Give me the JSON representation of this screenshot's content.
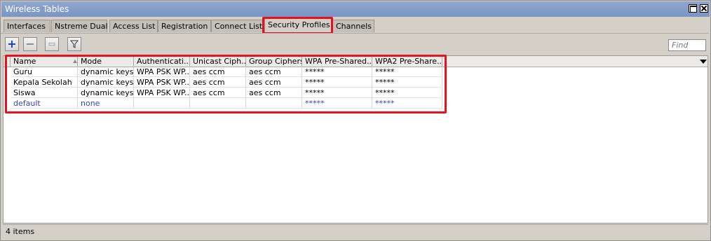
{
  "window": {
    "title": "Wireless Tables"
  },
  "tabs": [
    {
      "label": "Interfaces"
    },
    {
      "label": "Nstreme Dual"
    },
    {
      "label": "Access List"
    },
    {
      "label": "Registration"
    },
    {
      "label": "Connect List"
    },
    {
      "label": "Security Profiles",
      "active": true
    },
    {
      "label": "Channels"
    }
  ],
  "toolbar": {
    "add_icon": "plus-icon",
    "remove_icon": "minus-icon",
    "copy_icon": "comment-icon",
    "filter_icon": "filter-icon",
    "find_placeholder": "Find"
  },
  "table": {
    "columns": [
      "Name",
      "Mode",
      "Authenticati...",
      "Unicast Ciph...",
      "Group Ciphers",
      "WPA Pre-Shared...",
      "WPA2 Pre-Share..."
    ],
    "rows": [
      [
        "Guru",
        "dynamic keys",
        "WPA PSK WP...",
        "aes ccm",
        "aes ccm",
        "*****",
        "*****"
      ],
      [
        "Kepala Sekolah",
        "dynamic keys",
        "WPA PSK WP...",
        "aes ccm",
        "aes ccm",
        "*****",
        "*****"
      ],
      [
        "Siswa",
        "dynamic keys",
        "WPA PSK WP...",
        "aes ccm",
        "aes ccm",
        "*****",
        "*****"
      ],
      [
        "default",
        "none",
        "",
        "",
        "",
        "*****",
        "*****"
      ]
    ]
  },
  "status": {
    "items": "4 items"
  },
  "colors": {
    "highlight": "#e5111c",
    "default_row": "#3b3bc8",
    "titlebar": "#7b94c4"
  }
}
